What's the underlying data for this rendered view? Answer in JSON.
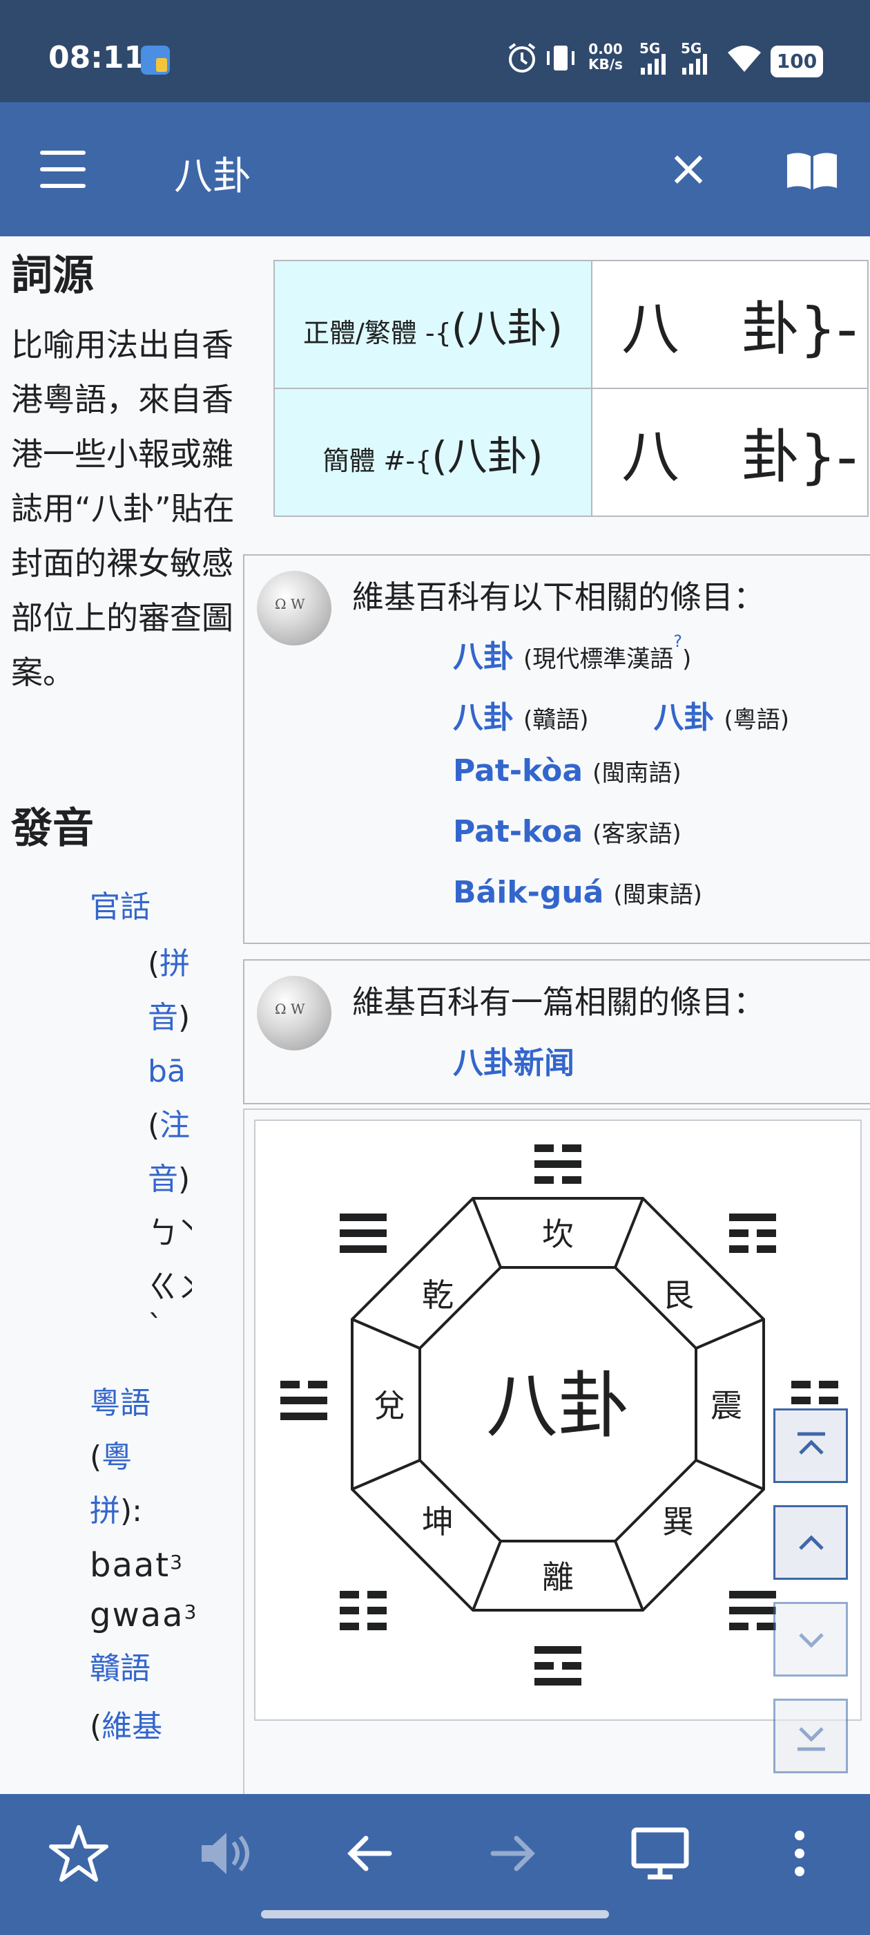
{
  "status_bar": {
    "time": "08:11",
    "net_speed_value": "0.00",
    "net_speed_unit": "KB/s",
    "signal1": "5G",
    "signal2": "5G",
    "battery": "100"
  },
  "toolbar": {
    "title": "八卦",
    "menu_icon": "hamburger-icon",
    "close_icon": "close-icon",
    "book_icon": "open-book-icon"
  },
  "etymology": {
    "heading": "詞源",
    "text": "比喻用法出自香港粵語，來自香港一些小報或雜誌用“八卦”貼在封面的裸女敏感部位上的審查圖案。"
  },
  "pronunciation": {
    "heading": "發音",
    "mandarin": {
      "name": "官話",
      "pinyin_label_1": "拼",
      "pinyin_label_2": "音",
      "pinyin_value": "bā",
      "zhuyin_label_1": "注",
      "zhuyin_label_2": "音",
      "zhuyin_line1": "ㄅㄚ",
      "zhuyin_line2": "ㄍㄨㄚ",
      "zhuyin_line3": "ˋ"
    },
    "cantonese": {
      "name": "粵語",
      "label_1": "粵",
      "label_2": "拼",
      "colon": "):",
      "syllable1": "baat",
      "tone1": "3",
      "syllable2": "gwaa",
      "tone2": "3"
    },
    "gan": {
      "name": "贛語",
      "label": "維基"
    }
  },
  "forms_table": {
    "rows": [
      {
        "label": "正體/繁體 -{",
        "label_chars": "(八卦)",
        "char1": "八",
        "char2": "卦}-"
      },
      {
        "label": "簡體 #-{",
        "label_chars": "(八卦)",
        "char1": "八",
        "char2": "卦}-"
      }
    ]
  },
  "sister_box_1": {
    "title": "維基百科有以下相關的條目：",
    "rows": [
      [
        {
          "link": "八卦",
          "note": "(現代標準漢語",
          "help": "?",
          "close": ")"
        }
      ],
      [
        {
          "link": "八卦",
          "note": "(贛語)"
        },
        {
          "link": "八卦",
          "note": "(粵語)"
        }
      ],
      [
        {
          "link": "Pat-kòa",
          "note": "(閩南語)"
        }
      ],
      [
        {
          "link": "Pat-koa",
          "note": "(客家語)"
        }
      ],
      [
        {
          "link": "Báik-guá",
          "note": "(閩東語)"
        }
      ]
    ]
  },
  "sister_box_2": {
    "title": "維基百科有一篇相關的條目：",
    "link": "八卦新闻"
  },
  "bagua": {
    "center": "八卦",
    "segments": [
      "坎",
      "艮",
      "震",
      "巽",
      "離",
      "坤",
      "兌",
      "乾"
    ]
  },
  "nav_buttons": [
    "scroll-top-icon",
    "scroll-up-icon",
    "scroll-down-icon",
    "scroll-bottom-icon"
  ],
  "bottom_bar": [
    "star-icon",
    "speaker-icon",
    "back-arrow-icon",
    "forward-arrow-icon",
    "desktop-icon",
    "more-vert-icon"
  ]
}
